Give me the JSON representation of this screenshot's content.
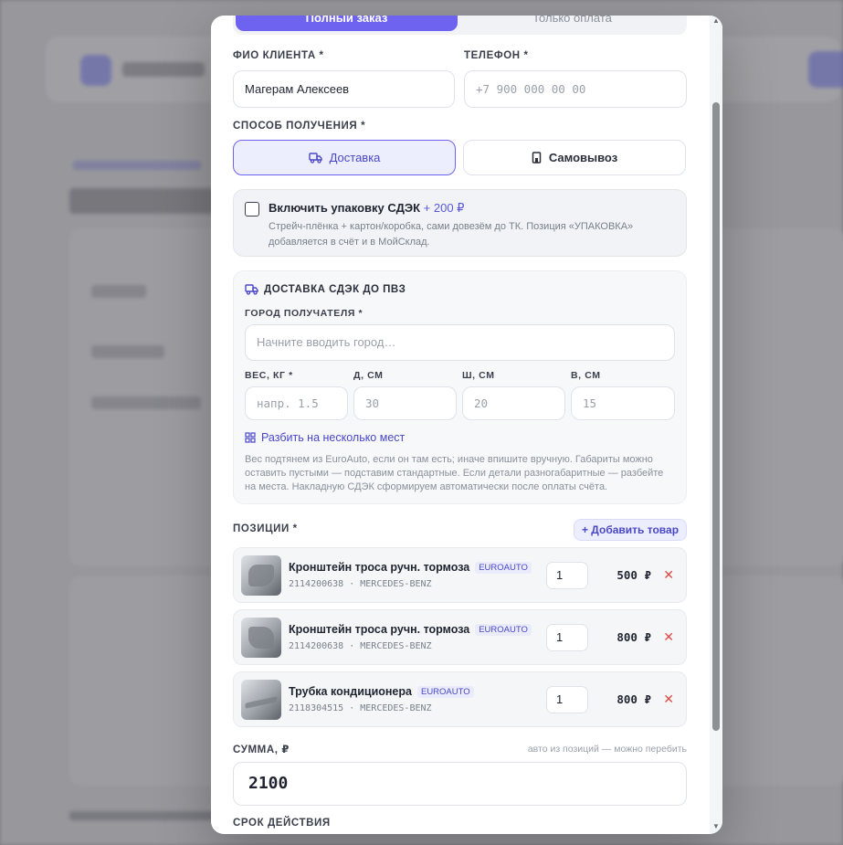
{
  "order_type": {
    "active": "Полный заказ",
    "inactive": "Только оплата"
  },
  "client": {
    "label": "ФИО КЛИЕНТА *",
    "value": "Магерам Алексеев"
  },
  "phone": {
    "label": "ТЕЛЕФОН *",
    "placeholder": "+7 900 000 00 00"
  },
  "receive": {
    "label": "СПОСОБ ПОЛУЧЕНИЯ *",
    "delivery": "Доставка",
    "pickup": "Самовывоз"
  },
  "packaging": {
    "title": "Включить упаковку СДЭК",
    "price": "+ 200 ₽",
    "description": "Стрейч-плёнка + картон/коробка, сами довезём до ТК. Позиция «УПАКОВКА» добавляется в счёт и в МойСклад."
  },
  "cdek": {
    "title": "ДОСТАВКА СДЭК ДО ПВЗ",
    "city_label": "ГОРОД ПОЛУЧАТЕЛЯ *",
    "city_placeholder": "Начните вводить город…",
    "weight_label": "ВЕС, КГ *",
    "weight_placeholder": "напр. 1.5",
    "length_label": "Д, СМ",
    "length_placeholder": "30",
    "width_label": "Ш, СМ",
    "width_placeholder": "20",
    "height_label": "В, СМ",
    "height_placeholder": "15",
    "split_label": "Разбить на несколько мест",
    "note": "Вес подтянем из EuroAuto, если он там есть; иначе впишите вручную. Габариты можно оставить пустыми — подставим стандартные. Если детали разногабаритные — разбейте на места. Накладную СДЭК сформируем автоматически после оплаты счёта."
  },
  "positions": {
    "label": "ПОЗИЦИИ *",
    "add_label": "+ Добавить товар",
    "items": [
      {
        "name": "Кронштейн троса ручн. тормоза",
        "badge": "EUROAUTO",
        "sku": "2114200638 · MERCEDES-BENZ",
        "qty": "1",
        "price": "500 ₽"
      },
      {
        "name": "Кронштейн троса ручн. тормоза",
        "badge": "EUROAUTO",
        "sku": "2114200638 · MERCEDES-BENZ",
        "qty": "1",
        "price": "800 ₽"
      },
      {
        "name": "Трубка кондиционера",
        "badge": "EUROAUTO",
        "sku": "2118304515 · MERCEDES-BENZ",
        "qty": "1",
        "price": "800 ₽"
      }
    ]
  },
  "sum": {
    "label": "СУММА, ₽",
    "hint": "авто из позиций — можно перебить",
    "value": "2100"
  },
  "validity": {
    "label": "СРОК ДЕЙСТВИЯ"
  },
  "icons": {
    "truck": "truck-icon",
    "store": "store-icon",
    "grid": "grid-icon",
    "remove": "close-icon"
  },
  "colors": {
    "accent": "#6e63f0",
    "danger": "#e04848"
  }
}
